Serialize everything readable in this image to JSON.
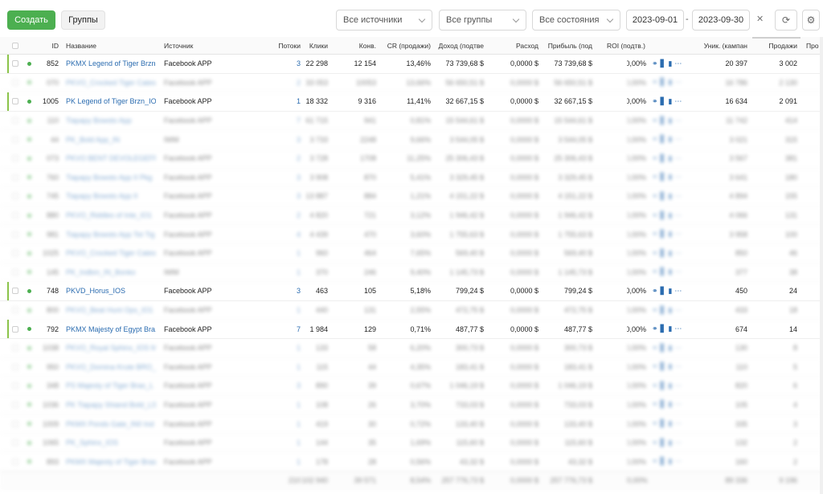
{
  "toolbar": {
    "create_label": "Создать",
    "groups_label": "Группы",
    "filter_sources": "Все источники",
    "filter_groups": "Все группы",
    "filter_states": "Все состояния",
    "date_from": "2023-09-01",
    "date_sep": "-",
    "date_to": "2023-09-30",
    "clear_symbol": "✕",
    "refresh_symbol": "⟳",
    "settings_symbol": "⚙"
  },
  "table": {
    "columns": {
      "id": "ID",
      "name": "Название",
      "source": "Источник",
      "streams": "Потоки",
      "clicks": "Клики",
      "conv": "Конв.",
      "cr": "CR (продажи)",
      "revenue": "Доход (подтве",
      "cost": "Расход",
      "profit": "Прибыль (под",
      "roi": "ROI (подтв.)",
      "unique": "Уник. (кампан",
      "sales": "Продажи",
      "more": "Про"
    },
    "rows": [
      {
        "id": "852",
        "name": "PKMX Legend of Tiger Brzn...",
        "source": "Facebook APP",
        "streams": "3",
        "clicks": "22 298",
        "conv": "12 154",
        "cr": "13,46%",
        "revenue": "73 739,68 $",
        "cost": "0,0000 $",
        "profit": "73 739,68 $",
        "roi": "0,00%",
        "unique": "20 397",
        "sales": "3 002",
        "blurred": false
      },
      {
        "id": "070",
        "name": "PKVO_Crocked Tiger Cates",
        "source": "Facebook APP",
        "streams": "2",
        "clicks": "33 053",
        "conv": "10053",
        "cr": "13,66%",
        "revenue": "56 650,51 $",
        "cost": "0,0000 $",
        "profit": "56 650,51 $",
        "roi": "0,00%",
        "unique": "16 786",
        "sales": "2 130",
        "blurred": true
      },
      {
        "id": "1005",
        "name": "PK Legend of Tiger Brzn_IO...",
        "source": "Facebook APP",
        "streams": "1",
        "clicks": "18 332",
        "conv": "9 316",
        "cr": "11,41%",
        "revenue": "32 667,15 $",
        "cost": "0,0000 $",
        "profit": "32 667,15 $",
        "roi": "0,00%",
        "unique": "16 634",
        "sales": "2 091",
        "blurred": false
      },
      {
        "id": "110",
        "name": "Tiapapy Bowsto App",
        "source": "Facebook APP",
        "streams": "7",
        "clicks": "61 715",
        "conv": "941",
        "cr": "0,81%",
        "revenue": "15 544,61 $",
        "cost": "0,0000 $",
        "profit": "15 544,61 $",
        "roi": "0,00%",
        "unique": "11 742",
        "sales": "414",
        "blurred": true
      },
      {
        "id": "44",
        "name": "PK_Bold App_IN",
        "source": "IWM",
        "streams": "3",
        "clicks": "3 733",
        "conv": "2248",
        "cr": "9,66%",
        "revenue": "3 544,05 $",
        "cost": "0,0000 $",
        "profit": "3 544,05 $",
        "roi": "0,00%",
        "unique": "3 021",
        "sales": "315",
        "blurred": true
      },
      {
        "id": "073",
        "name": "PKVO BENT DEVOLEGEFP",
        "source": "Facebook APP",
        "streams": "2",
        "clicks": "3 728",
        "conv": "1708",
        "cr": "11,25%",
        "revenue": "25 306,43 $",
        "cost": "0,0000 $",
        "profit": "25 306,43 $",
        "roi": "0,00%",
        "unique": "3 567",
        "sales": "381",
        "blurred": true
      },
      {
        "id": "760",
        "name": "Tiapapy Bowsto App II Pkg",
        "source": "Facebook APP",
        "streams": "3",
        "clicks": "3 908",
        "conv": "870",
        "cr": "5,41%",
        "revenue": "3 329,45 $",
        "cost": "0,0000 $",
        "profit": "3 329,45 $",
        "roi": "0,00%",
        "unique": "3 641",
        "sales": "180",
        "blurred": true
      },
      {
        "id": "745",
        "name": "Tiapapy Bowsto App II",
        "source": "Facebook APP",
        "streams": "3",
        "clicks": "13 887",
        "conv": "884",
        "cr": "1,21%",
        "revenue": "4 151,22 $",
        "cost": "0,0000 $",
        "profit": "4 151,22 $",
        "roi": "0,00%",
        "unique": "4 894",
        "sales": "155",
        "blurred": true
      },
      {
        "id": "880",
        "name": "PKVO_Riddles of Inte_IO1",
        "source": "Facebook APP",
        "streams": "2",
        "clicks": "4 820",
        "conv": "721",
        "cr": "3,12%",
        "revenue": "1 946,42 $",
        "cost": "0,0000 $",
        "profit": "1 946,42 $",
        "roi": "0,00%",
        "unique": "4 066",
        "sales": "131",
        "blurred": true
      },
      {
        "id": "981",
        "name": "Tiapapy Bowsto App Tot Tig",
        "source": "Facebook APP",
        "streams": "4",
        "clicks": "4 439",
        "conv": "470",
        "cr": "3,60%",
        "revenue": "1 755,63 $",
        "cost": "0,0000 $",
        "profit": "1 755,63 $",
        "roi": "0,00%",
        "unique": "3 958",
        "sales": "100",
        "blurred": true
      },
      {
        "id": "1025",
        "name": "PKVO_Crocked Tiger Cates",
        "source": "Facebook APP",
        "streams": "1",
        "clicks": "960",
        "conv": "464",
        "cr": "7,65%",
        "revenue": "569,40 $",
        "cost": "0,0000 $",
        "profit": "569,40 $",
        "roi": "0,00%",
        "unique": "850",
        "sales": "46",
        "blurred": true
      },
      {
        "id": "145",
        "name": "PK_Indbm_IN_Bonko",
        "source": "IWM",
        "streams": "1",
        "clicks": "370",
        "conv": "246",
        "cr": "9,40%",
        "revenue": "1 145,73 $",
        "cost": "0,0000 $",
        "profit": "1 145,73 $",
        "roi": "0,00%",
        "unique": "377",
        "sales": "38",
        "blurred": true
      },
      {
        "id": "748",
        "name": "PKVD_Horus_IOS",
        "source": "Facebook APP",
        "streams": "3",
        "clicks": "463",
        "conv": "105",
        "cr": "5,18%",
        "revenue": "799,24 $",
        "cost": "0,0000 $",
        "profit": "799,24 $",
        "roi": "0,00%",
        "unique": "450",
        "sales": "24",
        "blurred": false
      },
      {
        "id": "800",
        "name": "PKVO_Beat Hunt Ops_IO1",
        "source": "Facebook APP",
        "streams": "1",
        "clicks": "440",
        "conv": "131",
        "cr": "2,55%",
        "revenue": "472,75 $",
        "cost": "0,0000 $",
        "profit": "472,75 $",
        "roi": "0,00%",
        "unique": "433",
        "sales": "18",
        "blurred": true
      },
      {
        "id": "792",
        "name": "PKMX Majesty of Egypt Bra...",
        "source": "Facebook APP",
        "streams": "7",
        "clicks": "1 984",
        "conv": "129",
        "cr": "0,71%",
        "revenue": "487,77 $",
        "cost": "0,0000 $",
        "profit": "487,77 $",
        "roi": "0,00%",
        "unique": "674",
        "sales": "14",
        "blurred": false
      },
      {
        "id": "1038",
        "name": "PKVO_Royal Sphinx_IOS M",
        "source": "Facebook APP",
        "streams": "1",
        "clicks": "133",
        "conv": "58",
        "cr": "6,20%",
        "revenue": "300,73 $",
        "cost": "0,0000 $",
        "profit": "300,73 $",
        "roi": "0,00%",
        "unique": "130",
        "sales": "8",
        "blurred": true
      },
      {
        "id": "950",
        "name": "PKVO_Domina Krute BRO_L",
        "source": "Facebook APP",
        "streams": "1",
        "clicks": "115",
        "conv": "44",
        "cr": "4,35%",
        "revenue": "183,41 $",
        "cost": "0,0000 $",
        "profit": "183,41 $",
        "roi": "0,00%",
        "unique": "110",
        "sales": "5",
        "blurred": true
      },
      {
        "id": "348",
        "name": "PS Majesty of Tiger Bras_L",
        "source": "Facebook APP",
        "streams": "3",
        "clicks": "890",
        "conv": "39",
        "cr": "0,67%",
        "revenue": "1 046,19 $",
        "cost": "0,0000 $",
        "profit": "1 046,19 $",
        "roi": "0,00%",
        "unique": "820",
        "sales": "6",
        "blurred": true
      },
      {
        "id": "1036",
        "name": "PK Tiapapy Shiand Bold_LS",
        "source": "Facebook APP",
        "streams": "1",
        "clicks": "108",
        "conv": "26",
        "cr": "3,70%",
        "revenue": "733,03 $",
        "cost": "0,0000 $",
        "profit": "733,03 $",
        "roi": "0,00%",
        "unique": "105",
        "sales": "4",
        "blurred": true
      },
      {
        "id": "1009",
        "name": "PKMX Ponds Gate_IN0 Ind",
        "source": "Facebook APP",
        "streams": "1",
        "clicks": "419",
        "conv": "30",
        "cr": "0,72%",
        "revenue": "133,40 $",
        "cost": "0,0000 $",
        "profit": "133,40 $",
        "roi": "0,00%",
        "unique": "335",
        "sales": "3",
        "blurred": true
      },
      {
        "id": "1065",
        "name": "PK_Sphinx_IOS",
        "source": "Facebook APP",
        "streams": "1",
        "clicks": "144",
        "conv": "35",
        "cr": "1,69%",
        "revenue": "115,60 $",
        "cost": "0,0000 $",
        "profit": "115,60 $",
        "roi": "0,00%",
        "unique": "132",
        "sales": "2",
        "blurred": true
      },
      {
        "id": "893",
        "name": "PKMX Majesty of Tiger Bras",
        "source": "Facebook APP",
        "streams": "1",
        "clicks": "178",
        "conv": "28",
        "cr": "0,56%",
        "revenue": "43,32 $",
        "cost": "0,0000 $",
        "profit": "43,32 $",
        "roi": "0,00%",
        "unique": "160",
        "sales": "2",
        "blurred": true
      }
    ],
    "totals": {
      "streams": "210",
      "clicks": "102 940",
      "conv": "39 571",
      "cr": "8,54%",
      "revenue": "257 776,73 $",
      "cost": "0,0000 $",
      "profit": "257 776,73 $",
      "roi": "0,00%",
      "unique": "89 336",
      "sales": "9 196"
    },
    "action_icons": {
      "link": "link-icon",
      "stats": "bar-chart-icon",
      "report": "document-icon",
      "more": "more-icon"
    }
  }
}
